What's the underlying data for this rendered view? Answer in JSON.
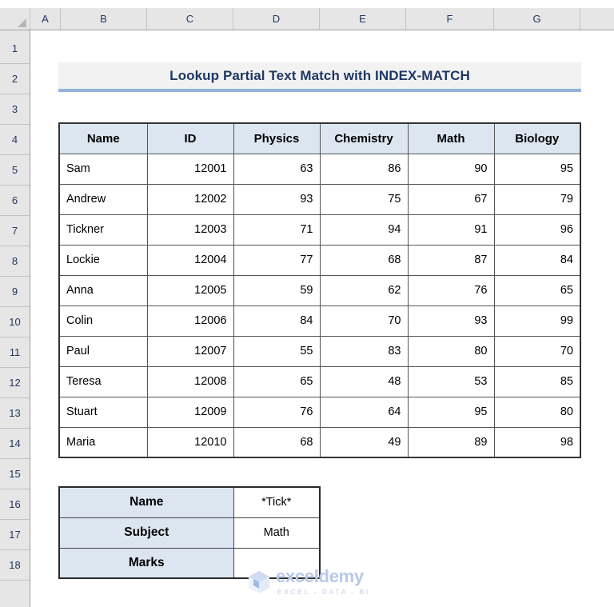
{
  "app": {
    "type": "spreadsheet",
    "colors": {
      "header_fill": "#dce6f1",
      "title_underline": "#95b3d7",
      "title_text": "#1f3864",
      "grid_header": "#e6e6e6",
      "watermark": "#b9c7e8"
    }
  },
  "grid": {
    "column_headers": [
      "A",
      "B",
      "C",
      "D",
      "E",
      "F",
      "G"
    ],
    "row_headers": [
      "1",
      "2",
      "3",
      "4",
      "5",
      "6",
      "7",
      "8",
      "9",
      "10",
      "11",
      "12",
      "13",
      "14",
      "15",
      "16",
      "17",
      "18"
    ],
    "corner_icon": "select-all-triangle-icon"
  },
  "title": {
    "text": "Lookup Partial Text Match with INDEX-MATCH"
  },
  "main_table": {
    "columns": [
      "Name",
      "ID",
      "Physics",
      "Chemistry",
      "Math",
      "Biology"
    ],
    "rows": [
      [
        "Sam",
        "12001",
        "63",
        "86",
        "90",
        "95"
      ],
      [
        "Andrew",
        "12002",
        "93",
        "75",
        "67",
        "79"
      ],
      [
        "Tickner",
        "12003",
        "71",
        "94",
        "91",
        "96"
      ],
      [
        "Lockie",
        "12004",
        "77",
        "68",
        "87",
        "84"
      ],
      [
        "Anna",
        "12005",
        "59",
        "62",
        "76",
        "65"
      ],
      [
        "Colin",
        "12006",
        "84",
        "70",
        "93",
        "99"
      ],
      [
        "Paul",
        "12007",
        "55",
        "83",
        "80",
        "70"
      ],
      [
        "Teresa",
        "12008",
        "65",
        "48",
        "53",
        "85"
      ],
      [
        "Stuart",
        "12009",
        "76",
        "64",
        "95",
        "80"
      ],
      [
        "Maria",
        "12010",
        "68",
        "49",
        "89",
        "98"
      ]
    ]
  },
  "lookup_table": {
    "rows": [
      {
        "label": "Name",
        "value": "*Tick*"
      },
      {
        "label": "Subject",
        "value": "Math"
      },
      {
        "label": "Marks",
        "value": ""
      }
    ]
  },
  "watermark": {
    "name": "exceldemy",
    "tagline": "EXCEL - DATA - BI",
    "icon": "exceldemy-cube-logo-icon"
  }
}
